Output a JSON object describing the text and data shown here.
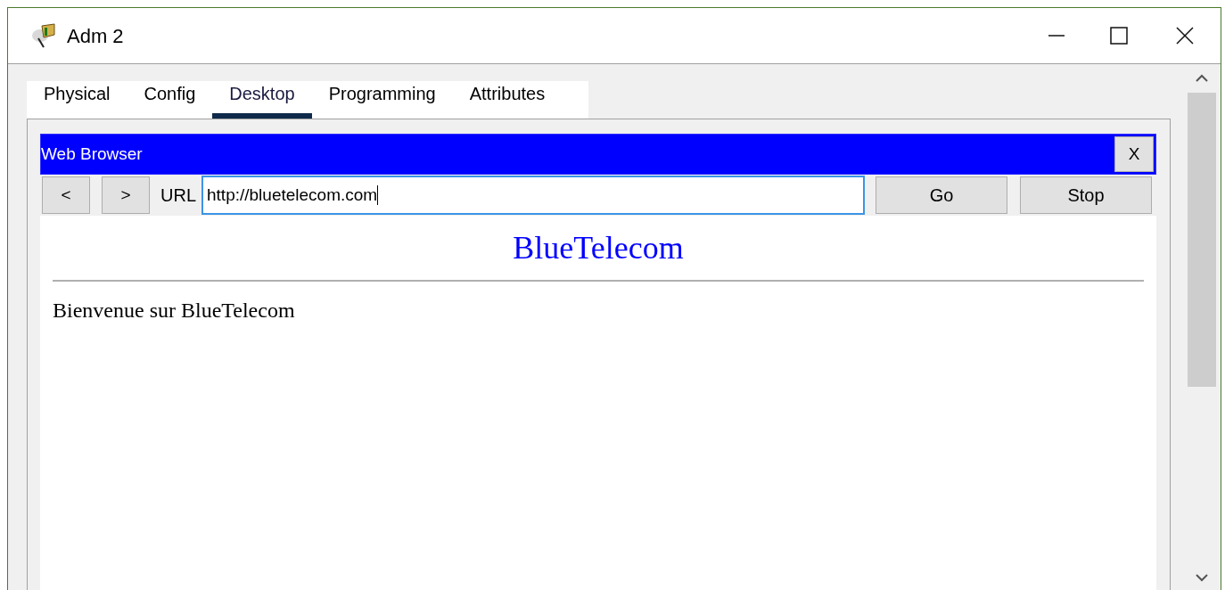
{
  "window": {
    "title": "Adm 2"
  },
  "tabs": [
    {
      "label": "Physical",
      "selected": false
    },
    {
      "label": "Config",
      "selected": false
    },
    {
      "label": "Desktop",
      "selected": true
    },
    {
      "label": "Programming",
      "selected": false
    },
    {
      "label": "Attributes",
      "selected": false
    }
  ],
  "browser": {
    "title": "Web Browser",
    "close_label": "X",
    "back_label": "<",
    "forward_label": ">",
    "url_label": "URL",
    "url": "http://bluetelecom.com",
    "go_label": "Go",
    "stop_label": "Stop"
  },
  "page": {
    "heading": "BlueTelecom",
    "text": "Bienvenue sur BlueTelecom"
  }
}
